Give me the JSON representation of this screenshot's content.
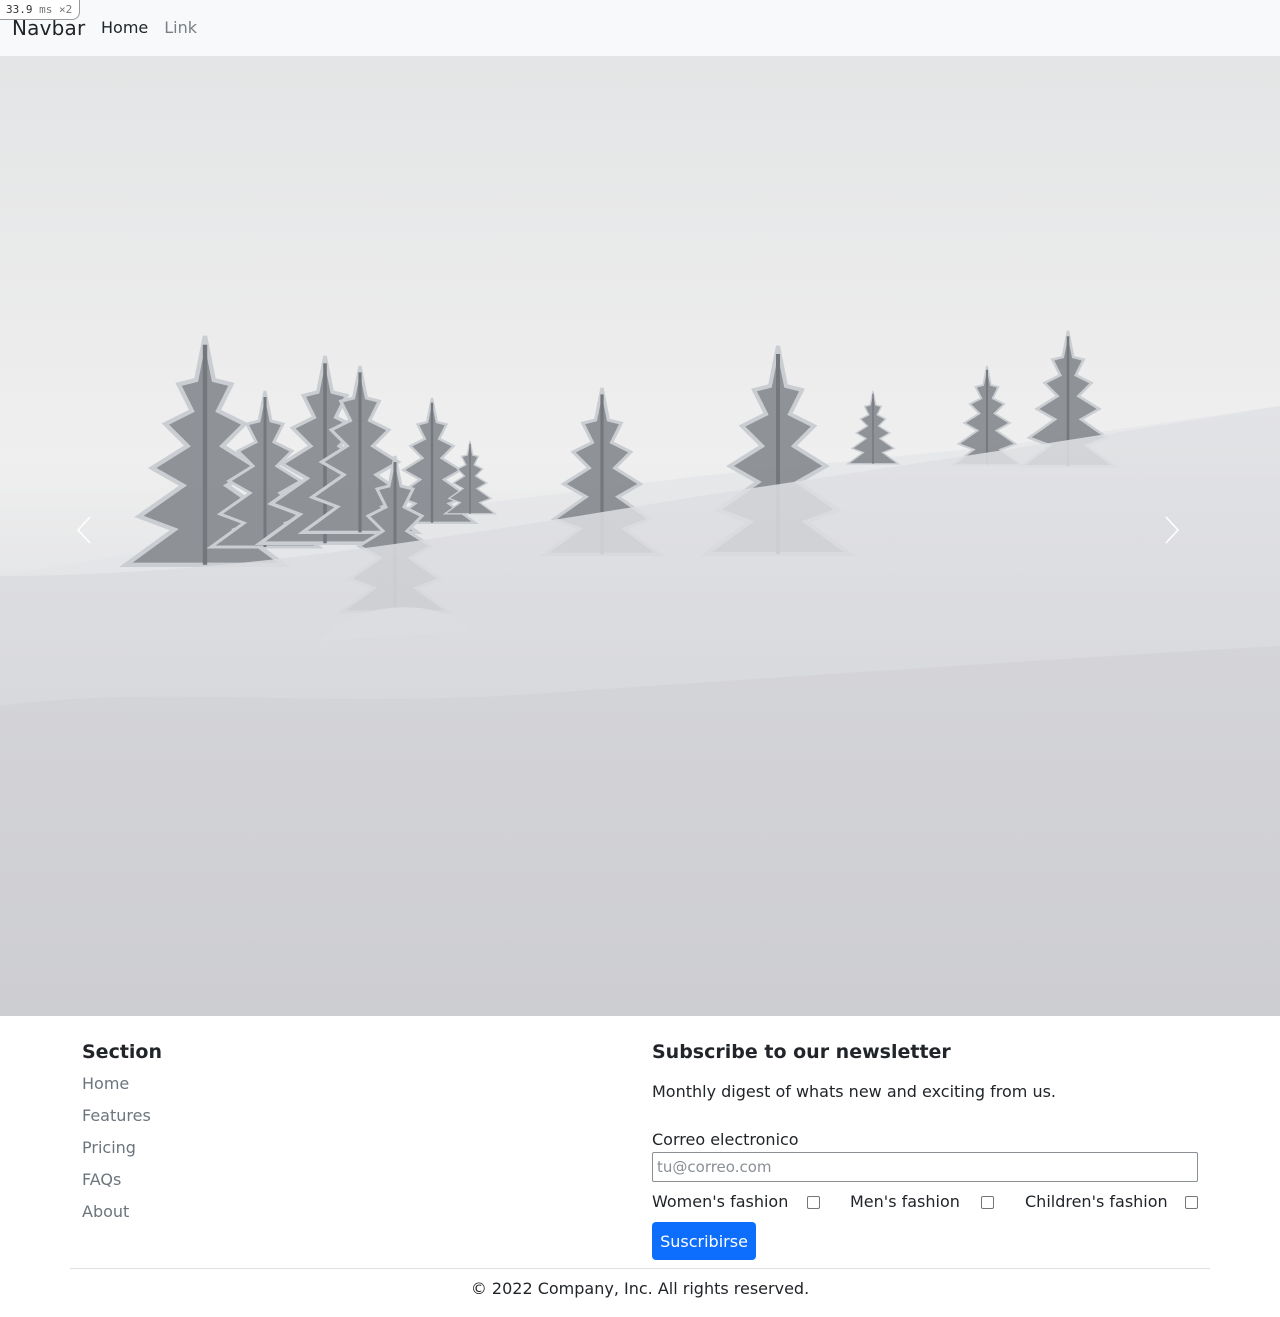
{
  "perf": {
    "value": "33.9",
    "unit": "ms",
    "multiplier": "×2"
  },
  "navbar": {
    "brand": "Navbar",
    "links": [
      {
        "label": "Home",
        "active": true
      },
      {
        "label": "Link",
        "active": false
      }
    ]
  },
  "carousel": {
    "prev_icon": "chevron-left-icon",
    "next_icon": "chevron-right-icon"
  },
  "footer": {
    "section_title": "Section",
    "section_links": [
      "Home",
      "Features",
      "Pricing",
      "FAQs",
      "About"
    ],
    "newsletter": {
      "title": "Subscribe to our newsletter",
      "description": "Monthly digest of whats new and exciting from us.",
      "email_label": "Correo electronico",
      "email_placeholder": "tu@correo.com",
      "email_value": "",
      "options": [
        {
          "label": "Women's fashion",
          "checked": false
        },
        {
          "label": "Men's fashion",
          "checked": false
        },
        {
          "label": "Children's fashion",
          "checked": false
        }
      ],
      "submit_label": "Suscribirse"
    },
    "copyright": "© 2022 Company, Inc. All rights reserved."
  },
  "colors": {
    "primary": "#0d6efd",
    "navbar_bg": "#f8f9fa",
    "muted_text": "#6c757d"
  }
}
